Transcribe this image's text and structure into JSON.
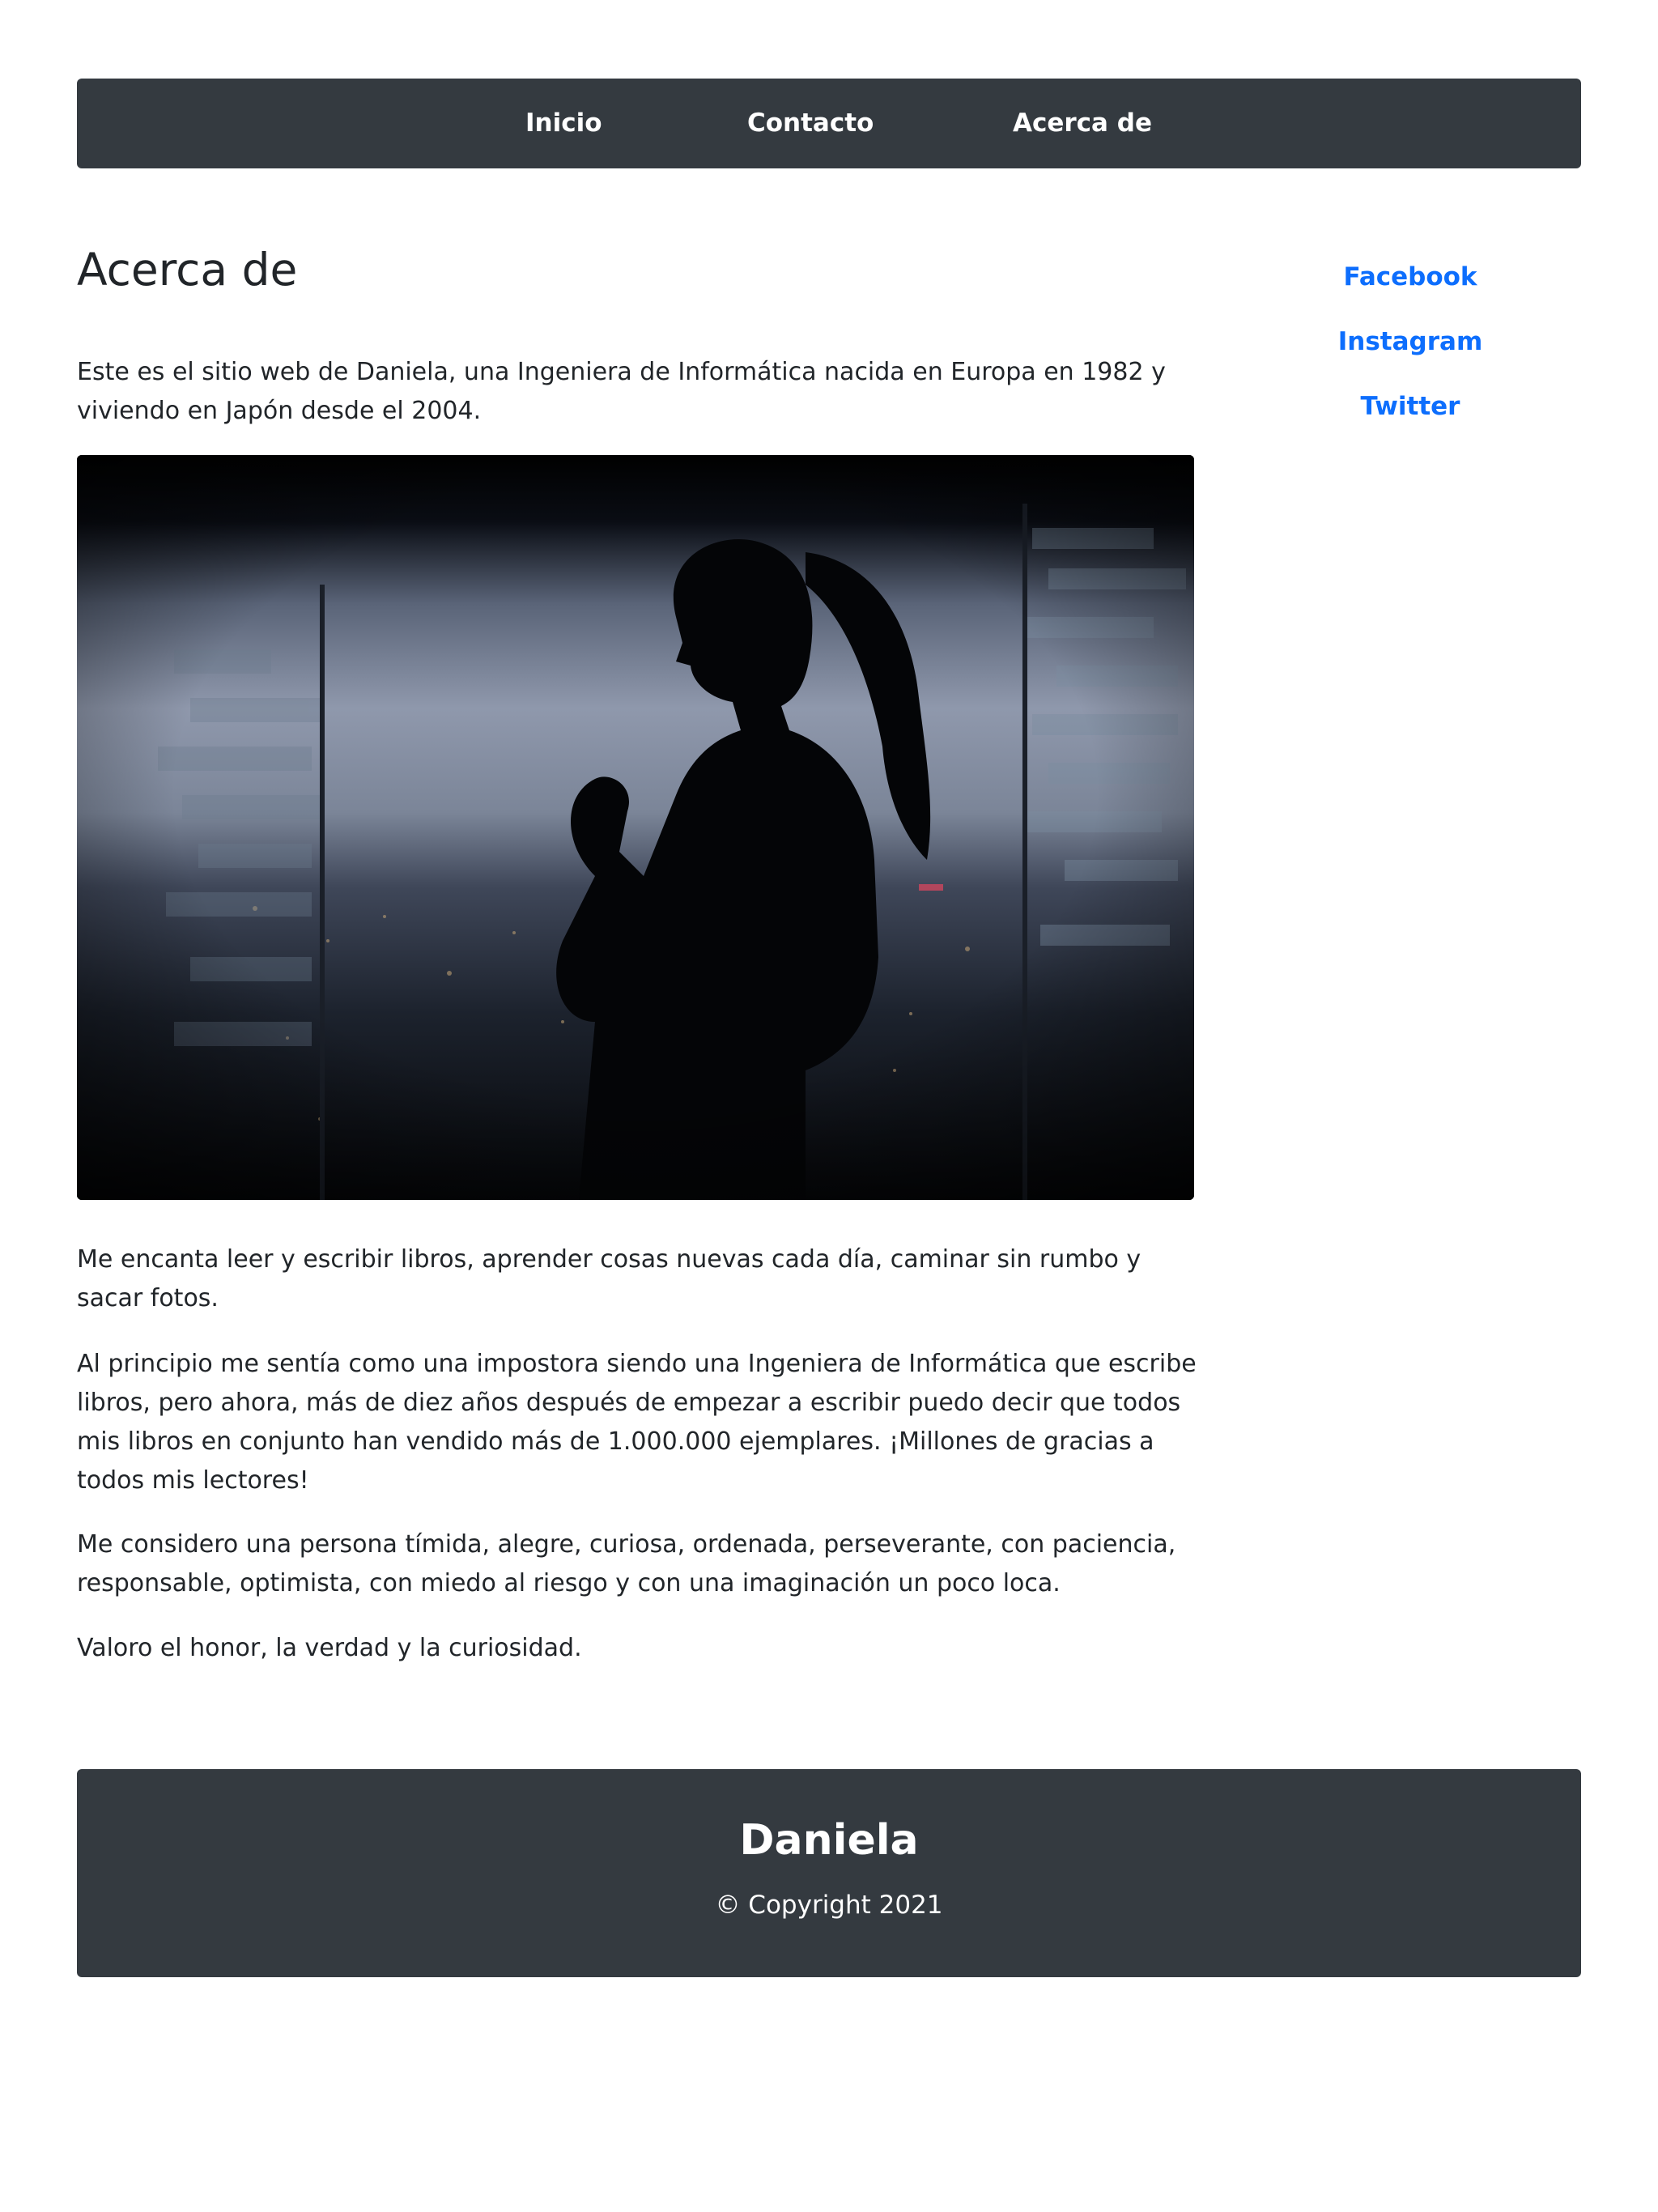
{
  "nav": {
    "items": [
      {
        "label": "Inicio"
      },
      {
        "label": "Contacto"
      },
      {
        "label": "Acerca de"
      }
    ]
  },
  "main": {
    "title": "Acerca de",
    "intro": "Este es el sitio web de Daniela, una Ingeniera de Informática nacida en Europa en 1982 y viviendo en Japón desde el 2004.",
    "paragraphs": [
      "Me encanta leer y escribir libros, aprender cosas nuevas cada día, caminar sin rumbo y sacar fotos.",
      "Al principio me sentía como una impostora siendo una Ingeniera de Informática que escribe libros, pero ahora, más de diez años después de empezar a escribir puedo decir que todos mis libros en conjunto han vendido más de 1.000.000 ejemplares. ¡Millones de gracias a todos mis lectores!",
      "Me considero una persona tímida, alegre, curiosa, ordenada, perseverante, con paciencia, responsable, optimista, con miedo al riesgo y con una imaginación un poco loca.",
      "Valoro el honor, la verdad y la curiosidad."
    ]
  },
  "sidebar": {
    "links": [
      {
        "label": "Facebook"
      },
      {
        "label": "Instagram"
      },
      {
        "label": "Twitter"
      }
    ]
  },
  "footer": {
    "name": "Daniela",
    "copyright": "© Copyright 2021"
  },
  "colors": {
    "dark": "#343a40",
    "link": "#0d6efd",
    "text": "#212529"
  }
}
